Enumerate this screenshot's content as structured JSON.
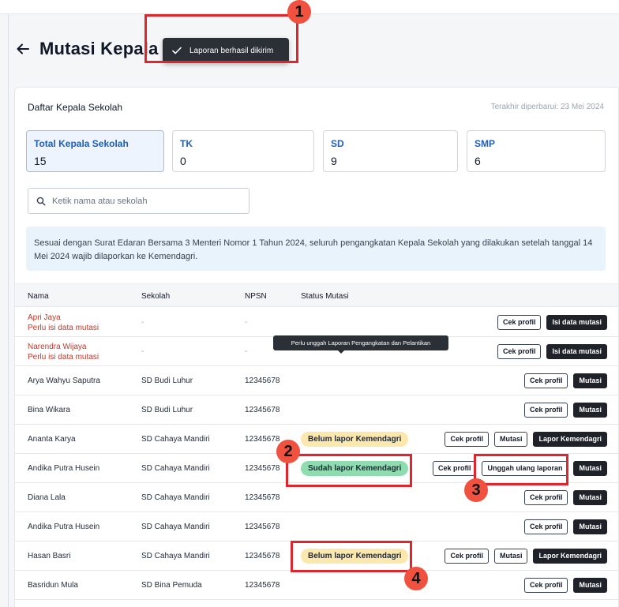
{
  "header": {
    "title": "Mutasi Kepala Se"
  },
  "toast": {
    "message": "Laporan berhasil dikirim"
  },
  "card": {
    "title": "Daftar Kepala Sekolah",
    "last_updated": "Terakhir diperbarui: 23 Mei 2024"
  },
  "stats": [
    {
      "label": "Total Kepala Sekolah",
      "value": "15"
    },
    {
      "label": "TK",
      "value": "0"
    },
    {
      "label": "SD",
      "value": "9"
    },
    {
      "label": "SMP",
      "value": "6"
    }
  ],
  "search": {
    "placeholder": "Ketik nama atau sekolah"
  },
  "notice": {
    "text": "Sesuai dengan Surat Edaran Bersama 3 Menteri Nomor 1 Tahun 2024, seluruh pengangkatan Kepala Sekolah yang dilakukan setelah tanggal 14 Mei 2024 wajib dilaporkan ke Kemendagri."
  },
  "table": {
    "headers": [
      "Nama",
      "Sekolah",
      "NPSN",
      "Status Mutasi"
    ],
    "rows": [
      {
        "name": "Apri Jaya",
        "note": "Perlu isi data mutasi",
        "school": "-",
        "npsn": "-",
        "status": "",
        "actions": [
          "Cek profil",
          "Isi data mutasi"
        ]
      },
      {
        "name": "Narendra Wijaya",
        "note": "Perlu isi data mutasi",
        "school": "-",
        "npsn": "-",
        "status": "",
        "actions": [
          "Cek profil",
          "Isi data mutasi"
        ]
      },
      {
        "name": "Arya Wahyu Saputra",
        "school": "SD Budi Luhur",
        "npsn": "12345678",
        "status": "",
        "actions": [
          "Cek profil",
          "Mutasi"
        ]
      },
      {
        "name": "Bina Wikara",
        "school": "SD Budi Luhur",
        "npsn": "12345678",
        "status": "",
        "actions": [
          "Cek profil",
          "Mutasi"
        ]
      },
      {
        "name": "Ananta Karya",
        "school": "SD Cahaya Mandiri",
        "npsn": "12345678",
        "status": "Belum lapor Kemendagri",
        "actions": [
          "Cek profil",
          "Mutasi",
          "Lapor Kemendagri"
        ]
      },
      {
        "name": "Andika Putra Husein",
        "school": "SD Cahaya Mandiri",
        "npsn": "12345678",
        "status": "Sudah lapor Kemendagri",
        "actions": [
          "Cek profil",
          "Unggah ulang laporan",
          "Mutasi"
        ]
      },
      {
        "name": "Diana Lala",
        "school": "SD Cahaya Mandiri",
        "npsn": "12345678",
        "status": "",
        "actions": [
          "Cek profil",
          "Mutasi"
        ]
      },
      {
        "name": "Andika Putra Husein",
        "school": "SD Cahaya Mandiri",
        "npsn": "12345678",
        "status": "",
        "actions": [
          "Cek profil",
          "Mutasi"
        ]
      },
      {
        "name": "Hasan Basri",
        "school": "SD Cahaya Mandiri",
        "npsn": "12345678",
        "status": "Belum lapor Kemendagri",
        "actions": [
          "Cek profil",
          "Mutasi",
          "Lapor Kemendagri"
        ]
      },
      {
        "name": "Basridun Mula",
        "school": "SD Bina Pemuda",
        "npsn": "12345678",
        "status": "",
        "actions": [
          "Cek profil",
          "Mutasi"
        ]
      }
    ]
  },
  "tooltip": {
    "text": "Perlu unggah Laporan Pengangkatan dan Pelantikan"
  },
  "annotations": [
    "1",
    "2",
    "3",
    "4"
  ],
  "colors": {
    "highlight": "#e0252c",
    "marker": "#f0523f",
    "accent": "#1f5fb5",
    "danger": "#c0392b"
  }
}
